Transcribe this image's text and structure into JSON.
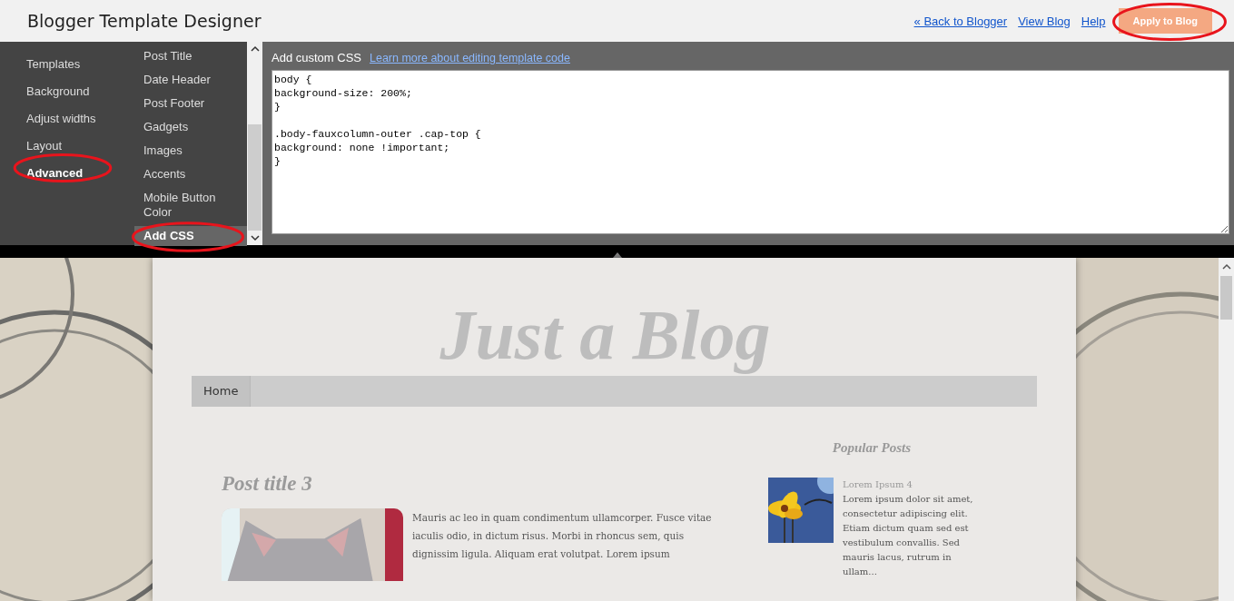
{
  "header": {
    "title": "Blogger Template Designer",
    "links": [
      "« Back to Blogger",
      "View Blog",
      "Help"
    ],
    "apply_button": {
      "label": "Apply to Blog",
      "circled": true
    }
  },
  "nav": [
    {
      "label": "Templates",
      "selected": false,
      "circled": false
    },
    {
      "label": "Background",
      "selected": false,
      "circled": false
    },
    {
      "label": "Adjust widths",
      "selected": false,
      "circled": false
    },
    {
      "label": "Layout",
      "selected": false,
      "circled": false
    },
    {
      "label": "Advanced",
      "selected": true,
      "circled": true
    }
  ],
  "subnav": [
    {
      "label": "Post Title",
      "selected": false,
      "circled": false
    },
    {
      "label": "Date Header",
      "selected": false,
      "circled": false
    },
    {
      "label": "Post Footer",
      "selected": false,
      "circled": false
    },
    {
      "label": "Gadgets",
      "selected": false,
      "circled": false
    },
    {
      "label": "Images",
      "selected": false,
      "circled": false
    },
    {
      "label": "Accents",
      "selected": false,
      "circled": false
    },
    {
      "label": "Mobile Button Color",
      "selected": false,
      "circled": false
    },
    {
      "label": "Add CSS",
      "selected": true,
      "circled": true
    }
  ],
  "editor": {
    "label": "Add custom CSS",
    "help_link": "Learn more about editing template code",
    "code": "body {\nbackground-size: 200%;\n}\n\n.body-fauxcolumn-outer .cap-top {\nbackground: none !important;\n}"
  },
  "preview": {
    "blog_title": "Just a Blog",
    "menu": [
      {
        "label": "Home",
        "selected": true
      }
    ],
    "post": {
      "title": "Post title 3",
      "text": "Mauris ac leo in quam condimentum ullamcorper. Fusce vitae iaculis odio, in dictum risus. Morbi in rhoncus sem, quis dignissim ligula. Aliquam erat volutpat. Lorem ipsum"
    },
    "sidebar": {
      "title": "Popular Posts",
      "items": [
        {
          "title": "Lorem Ipsum 4",
          "snippet": "Lorem ipsum dolor sit amet, consectetur adipiscing elit. Etiam dictum quam sed est vestibulum convallis. Sed mauris lacus, rutrum in ullam..."
        }
      ]
    }
  }
}
